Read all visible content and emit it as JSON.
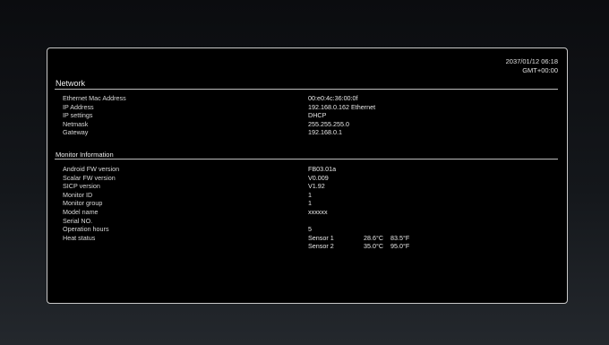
{
  "datetime": {
    "date_time": "2037/01/12 06:18",
    "timezone": "GMT+00:00"
  },
  "network": {
    "title": "Network",
    "rows": [
      {
        "label": "Ethernet Mac Address",
        "value": "00:e0:4c:36:00:0f"
      },
      {
        "label": "IP Address",
        "value": "192.168.0.162 Ethernet"
      },
      {
        "label": "IP settings",
        "value": "DHCP"
      },
      {
        "label": "Netmask",
        "value": "255.255.255.0"
      },
      {
        "label": "Gateway",
        "value": "192.168.0.1"
      }
    ]
  },
  "monitor": {
    "title": "Monitor Information",
    "rows": [
      {
        "label": "Android FW version",
        "value": "FB03.01a"
      },
      {
        "label": "Scalar FW version",
        "value": "V0.009"
      },
      {
        "label": "SICP version",
        "value": "V1.92"
      },
      {
        "label": "Monitor ID",
        "value": "1"
      },
      {
        "label": "Monitor group",
        "value": "1"
      },
      {
        "label": "Model name",
        "value": "xxxxxx"
      },
      {
        "label": "Serial NO.",
        "value": ""
      },
      {
        "label": "Operation hours",
        "value": "5"
      }
    ],
    "heat_status": {
      "label": "Heat status",
      "sensors": [
        {
          "name": "Sensor 1",
          "celsius": "28.6°C",
          "fahrenheit": "83.5°F"
        },
        {
          "name": "Sensor 2",
          "celsius": "35.0°C",
          "fahrenheit": "95.0°F"
        }
      ]
    }
  }
}
